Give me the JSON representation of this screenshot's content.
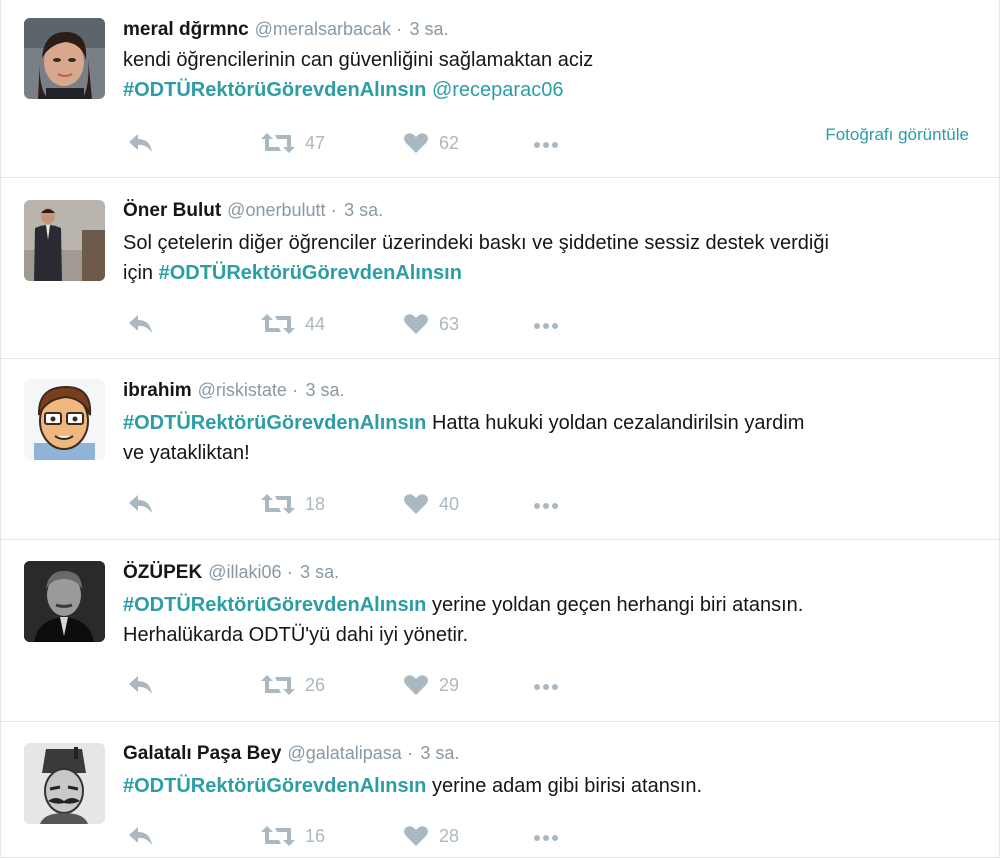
{
  "colors": {
    "link": "#2b9ea5",
    "muted": "#8899a6",
    "icon": "#aab8c2"
  },
  "tweets": [
    {
      "name": "meral dğrmnc",
      "handle": "@meralsarbacak",
      "separator": "·",
      "time": "3 sa.",
      "text_line1": "kendi öğrencilerinin can güvenliğini sağlamaktan aciz",
      "hashtag": "#ODTÜRektörüGörevdenAlınsın",
      "mention": "@receparac06",
      "retweets": "47",
      "likes": "62",
      "view_photo": "Fotoğrafı görüntüle"
    },
    {
      "name": "Öner Bulut",
      "handle": "@onerbulutt",
      "separator": "·",
      "time": "3 sa.",
      "text_line1": "Sol çetelerin diğer öğrenciler üzerindeki baskı ve şiddetine sessiz destek verdiği",
      "text_prefix": "için ",
      "hashtag": "#ODTÜRektörüGörevdenAlınsın",
      "retweets": "44",
      "likes": "63"
    },
    {
      "name": "ibrahim",
      "handle": "@riskistate",
      "separator": "·",
      "time": "3 sa.",
      "hashtag": "#ODTÜRektörüGörevdenAlınsın",
      "text_after": " Hatta hukuki yoldan cezalandirilsin yardim",
      "text_line2": "ve yatakliktan!",
      "retweets": "18",
      "likes": "40"
    },
    {
      "name": "ÖZÜPEK",
      "handle": "@illaki06",
      "separator": "·",
      "time": "3 sa.",
      "hashtag": "#ODTÜRektörüGörevdenAlınsın",
      "text_after": " yerine yoldan geçen herhangi biri atansın.",
      "text_line2": "Herhalükarda ODTÜ'yü dahi iyi yönetir.",
      "retweets": "26",
      "likes": "29"
    },
    {
      "name": "Galatalı Paşa Bey",
      "handle": "@galatalipasa",
      "separator": "·",
      "time": "3 sa.",
      "hashtag": "#ODTÜRektörüGörevdenAlınsın",
      "text_after": " yerine adam gibi birisi atansın.",
      "retweets": "16",
      "likes": "28"
    }
  ]
}
